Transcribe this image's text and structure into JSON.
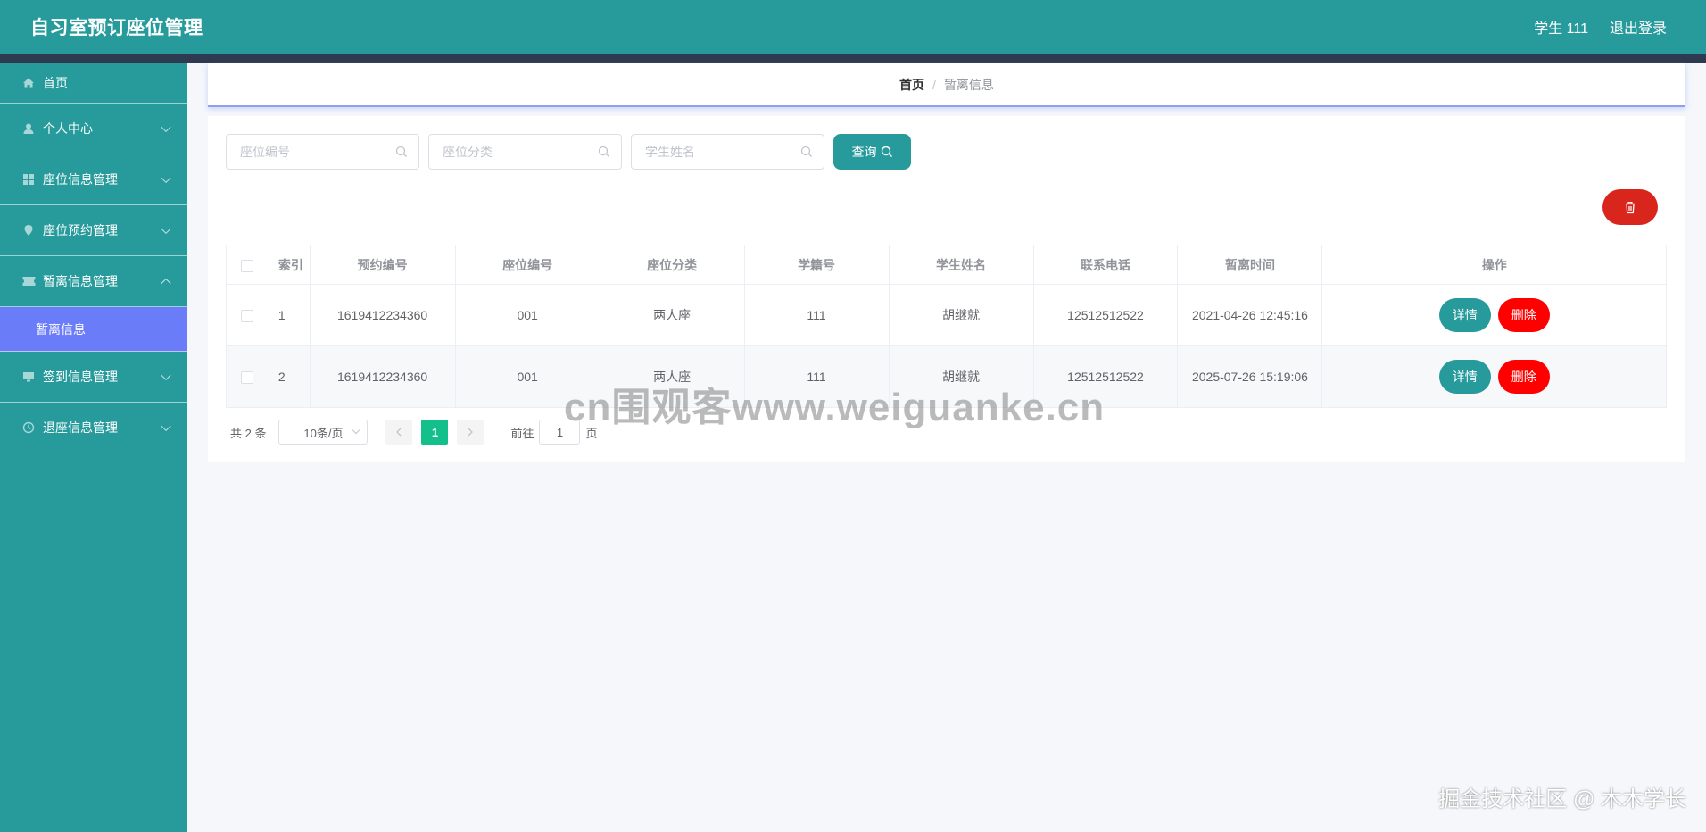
{
  "header": {
    "app_title": "自习室预订座位管理",
    "user_label": "学生 111",
    "logout_label": "退出登录"
  },
  "sidebar": {
    "items": [
      {
        "label": "首页",
        "icon": "home-icon"
      },
      {
        "label": "个人中心",
        "icon": "user-icon"
      },
      {
        "label": "座位信息管理",
        "icon": "grid-icon"
      },
      {
        "label": "座位预约管理",
        "icon": "location-icon"
      },
      {
        "label": "暂离信息管理",
        "icon": "ticket-icon"
      },
      {
        "label": "签到信息管理",
        "icon": "monitor-icon"
      },
      {
        "label": "退座信息管理",
        "icon": "clock-icon"
      }
    ],
    "sub_item": {
      "label": "暂离信息"
    }
  },
  "breadcrumb": {
    "home": "首页",
    "separator": "/",
    "current": "暂离信息"
  },
  "search": {
    "seat_no_placeholder": "座位编号",
    "seat_type_placeholder": "座位分类",
    "student_name_placeholder": "学生姓名",
    "query_label": "查询"
  },
  "table": {
    "headers": [
      "索引",
      "预约编号",
      "座位编号",
      "座位分类",
      "学籍号",
      "学生姓名",
      "联系电话",
      "暂离时间",
      "操作"
    ],
    "rows": [
      {
        "index": "1",
        "booking_no": "1619412234360",
        "seat_no": "001",
        "seat_type": "两人座",
        "student_id": "111",
        "student_name": "胡继就",
        "phone": "12512512522",
        "leave_time": "2021-04-26 12:45:16"
      },
      {
        "index": "2",
        "booking_no": "1619412234360",
        "seat_no": "001",
        "seat_type": "两人座",
        "student_id": "111",
        "student_name": "胡继就",
        "phone": "12512512522",
        "leave_time": "2025-07-26 15:19:06"
      }
    ],
    "detail_label": "详情",
    "delete_label": "删除"
  },
  "pagination": {
    "total": "共 2 条",
    "page_size": "10条/页",
    "current_page": "1",
    "goto_prefix": "前往",
    "goto_value": "1",
    "goto_suffix": "页"
  },
  "watermarks": {
    "center": "cn围观客www.weiguanke.cn",
    "corner": "掘金技术社区 @ 木木学长"
  },
  "colors": {
    "primary": "#279b9c",
    "header_strip": "#2e3a4f",
    "submenu_active": "#6b7cf9",
    "danger": "#ff0000",
    "batch_delete": "#d9261c",
    "page_active": "#13c08b"
  }
}
